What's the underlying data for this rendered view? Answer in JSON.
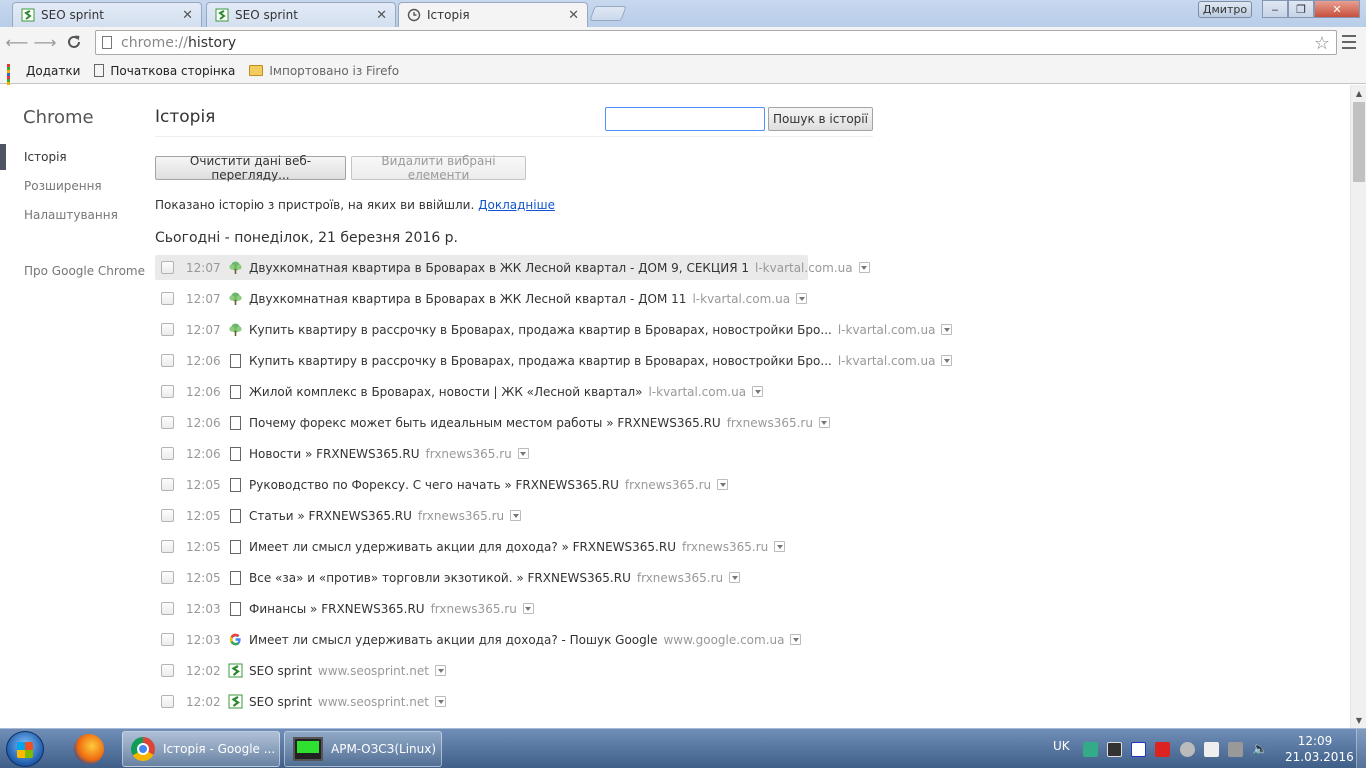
{
  "tabs": [
    {
      "title": "SEO sprint",
      "icon": "seosprint-icon"
    },
    {
      "title": "SEO sprint",
      "icon": "seosprint-icon"
    },
    {
      "title": "Історія",
      "icon": "history-icon"
    }
  ],
  "window": {
    "user_label": "Дмитро",
    "minimize": "‒",
    "maximize": "❐",
    "close": "✕"
  },
  "toolbar": {
    "url_scheme": "chrome://",
    "url_host": "history"
  },
  "bookmarks": [
    {
      "label": "Додатки",
      "icon": "apps-icon"
    },
    {
      "label": "Початкова сторінка",
      "icon": "page-icon"
    },
    {
      "label": "Імпортовано із Firefo",
      "icon": "folder-icon"
    }
  ],
  "sidebar": {
    "brand": "Chrome",
    "items": [
      {
        "label": "Історія",
        "selected": true
      },
      {
        "label": "Розширення",
        "selected": false
      },
      {
        "label": "Налаштування",
        "selected": false
      },
      {
        "label": "Про Google Chrome",
        "selected": false
      }
    ]
  },
  "main": {
    "title": "Історія",
    "search_button": "Пошук в історії",
    "search_value": "",
    "clear_button": "Очистити дані веб-перегляду...",
    "delete_button": "Видалити вибрані елементи",
    "info_text": "Показано історію з пристроїв, на яких ви ввійшли.",
    "info_link": "Докладніше",
    "day_heading": "Сьогодні - понеділок, 21 березня 2016 р."
  },
  "entries": [
    {
      "time": "12:07",
      "icon": "tree-icon",
      "title": "Двухкомнатная квартира в Броварах в ЖК Лесной квартал - ДОМ 9, СЕКЦИЯ 1",
      "domain": "l-kvartal.com.ua"
    },
    {
      "time": "12:07",
      "icon": "tree-icon",
      "title": "Двухкомнатная квартира в Броварах в ЖК Лесной квартал - ДОМ 11",
      "domain": "l-kvartal.com.ua"
    },
    {
      "time": "12:07",
      "icon": "tree-icon",
      "title": "Купить квартиру в рассрочку в Броварах, продажа квартир в Броварах, новостройки Бро...",
      "domain": "l-kvartal.com.ua"
    },
    {
      "time": "12:06",
      "icon": "page-icon",
      "title": "Купить квартиру в рассрочку в Броварах, продажа квартир в Броварах, новостройки Бро...",
      "domain": "l-kvartal.com.ua"
    },
    {
      "time": "12:06",
      "icon": "page-icon",
      "title": "Жилой комплекс в Броварах, новости | ЖК «Лесной квартал»",
      "domain": "l-kvartal.com.ua"
    },
    {
      "time": "12:06",
      "icon": "page-icon",
      "title": "Почему форекс может быть идеальным местом работы » FRXNEWS365.RU",
      "domain": "frxnews365.ru"
    },
    {
      "time": "12:06",
      "icon": "page-icon",
      "title": "Новости » FRXNEWS365.RU",
      "domain": "frxnews365.ru"
    },
    {
      "time": "12:05",
      "icon": "page-icon",
      "title": "Руководство по Форексу. С чего начать » FRXNEWS365.RU",
      "domain": "frxnews365.ru"
    },
    {
      "time": "12:05",
      "icon": "page-icon",
      "title": "Статьи » FRXNEWS365.RU",
      "domain": "frxnews365.ru"
    },
    {
      "time": "12:05",
      "icon": "page-icon",
      "title": "Имеет ли смысл удерживать акции для дохода? » FRXNEWS365.RU",
      "domain": "frxnews365.ru"
    },
    {
      "time": "12:05",
      "icon": "page-icon",
      "title": "Все «за» и «против» торговли экзотикой. » FRXNEWS365.RU",
      "domain": "frxnews365.ru"
    },
    {
      "time": "12:03",
      "icon": "page-icon",
      "title": "Финансы » FRXNEWS365.RU",
      "domain": "frxnews365.ru"
    },
    {
      "time": "12:03",
      "icon": "google-icon",
      "title": "Имеет ли смысл удерживать акции для дохода? - Пошук Google",
      "domain": "www.google.com.ua"
    },
    {
      "time": "12:02",
      "icon": "seosprint-icon",
      "title": "SEO sprint",
      "domain": "www.seosprint.net"
    },
    {
      "time": "12:02",
      "icon": "seosprint-icon",
      "title": "SEO sprint",
      "domain": "www.seosprint.net"
    }
  ],
  "taskbar": {
    "items": [
      {
        "label": "",
        "icon": "firefox-icon"
      },
      {
        "label": "Історія - Google ...",
        "icon": "chrome-icon"
      },
      {
        "label": "АРМ-ОЗСЗ(Linux)",
        "icon": "monitor-icon"
      }
    ],
    "language": "UK",
    "time": "12:09",
    "date": "21.03.2016"
  }
}
